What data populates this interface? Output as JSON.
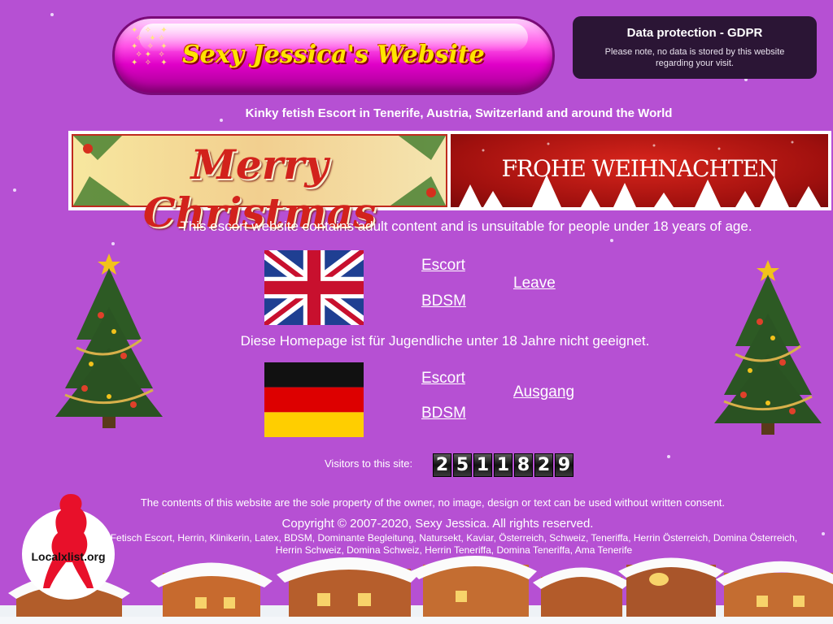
{
  "header": {
    "site_title": "Sexy Jessica's Website",
    "tagline": "Kinky fetish Escort in Tenerife, Austria, Switzerland and around the World"
  },
  "gdpr": {
    "title": "Data protection - GDPR",
    "text": "Please note, no data is stored by this website regarding your visit."
  },
  "banner": {
    "left_text": "Merry Christmas",
    "right_text": "FROHE WEIHNACHTEN"
  },
  "warnings": {
    "english": "This escort website contains adult content and is unsuitable for people under 18 years of age.",
    "german": "Diese Homepage ist für Jugendliche unter 18 Jahre nicht geeignet."
  },
  "links": {
    "english": {
      "escort": "Escort",
      "bdsm": "BDSM",
      "leave": "Leave"
    },
    "german": {
      "escort": "Escort",
      "bdsm": "BDSM",
      "leave": "Ausgang"
    }
  },
  "visitors": {
    "label": "Visitors to this site:",
    "digits": [
      "2",
      "5",
      "1",
      "1",
      "8",
      "2",
      "9"
    ]
  },
  "footer": {
    "notice": "The contents of this website are the sole property of the owner, no image, design or text can be used without written consent.",
    "copyright": "Copyright © 2007-2020, Sexy Jessica. All rights reserved.",
    "keywords": "Fetisch Escort, Herrin, Klinikerin, Latex, BDSM, Dominante Begleitung, Natursekt, Kaviar, Österreich, Schweiz, Teneriffa, Herrin Österreich, Domina Österreich, Herrin Schweiz, Domina Schweiz, Herrin Teneriffa, Domina Teneriffa, Ama Tenerife"
  },
  "logo": {
    "text": "Localxlist.org"
  },
  "colors": {
    "background": "#b650d3",
    "title_yellow": "#ffe400",
    "gdpr_bg": "#2b1535"
  }
}
